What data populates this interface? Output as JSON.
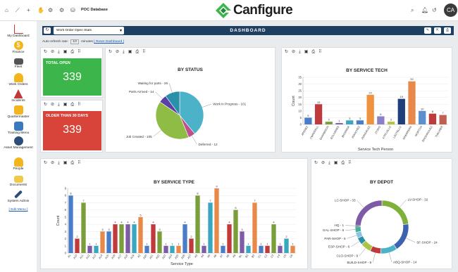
{
  "topbar": {
    "db_name": "POC Database",
    "brand": "Canfigure",
    "avatar": "CA"
  },
  "sidebar": {
    "items": [
      "My Dashboard",
      "Finance",
      "Fleet",
      "Work Orders",
      "Incidents",
      "Quartermaster",
      "Training Menu",
      "Asset Management",
      "People",
      "Documents",
      "System Admin"
    ],
    "edit": "[ Edit Menu ]"
  },
  "dashboard": {
    "title": "DASHBOARD",
    "select": "Work Order Open Stats",
    "auto_prefix": "Auto refresh rate:",
    "auto_value": "10",
    "auto_suffix": "minutes",
    "reset": "[ Reset Dashboard ]"
  },
  "kpis": {
    "open_label": "TOTAL OPEN",
    "open_value": "339",
    "old_label": "OLDER THAN 30 DAYS",
    "old_value": "339",
    "green": "#3cb54a",
    "red": "#d9443a"
  },
  "chart_data": [
    {
      "type": "pie",
      "title": "BY STATUS",
      "labels": [
        "Work in Progress - 101",
        "Deferred - 12",
        "Job Created - 105",
        "Parts Arrived - 14",
        "Waiting for parts - 26"
      ],
      "values": [
        101,
        12,
        105,
        14,
        26
      ],
      "colors": [
        "#4bb2c8",
        "#c0508c",
        "#8fbc44",
        "#5a3fa8",
        "#2a8fa8"
      ]
    },
    {
      "type": "bar",
      "title": "BY SERVICE TECH",
      "xlabel": "Service Tech  Person",
      "ylabel": "Count",
      "categories": [
        "APEREZ",
        "CWADDELL",
        "EHARBISON",
        "EOLIVARES",
        "JBOARDIA",
        "JSANCHEZ",
        "JSANDALEZ",
        "JTORO",
        "KTRUJILLO",
        "LSOTELLO",
        "MHERRERA",
        "MORTON",
        "RRODRIGUEZ",
        "THAUSER"
      ],
      "values": [
        5,
        15,
        2,
        1,
        3,
        3,
        22,
        6,
        2,
        19,
        32,
        10,
        8,
        7
      ],
      "colors": [
        "#4a7cc7",
        "#c0393b",
        "#7a9f3a",
        "#7d5ba6",
        "#3aa6c0",
        "#4a7cc7",
        "#f0913d",
        "#8b7fc7",
        "#b8c042",
        "#1f3f7a",
        "#e8894a",
        "#5a8fd0",
        "#c0393b",
        "#c05f50"
      ],
      "ylim": [
        0,
        35
      ]
    },
    {
      "type": "bar",
      "title": "BY SERVICE TYPE",
      "xlabel": "Service Type",
      "ylabel": "Count",
      "categories": [
        "A1",
        "A10",
        "A11",
        "A12",
        "A13",
        "A14",
        "A15",
        "A16",
        "A17",
        "A18",
        "A19",
        "A2",
        "A20",
        "A21",
        "A22",
        "A23",
        "A24",
        "A25",
        "A26",
        "A27",
        "A3",
        "A4",
        "A5",
        "A6",
        "A7",
        "A8",
        "A9",
        "B1",
        "B2",
        "B3",
        "C1",
        "C2",
        "C3",
        "C4",
        "C5",
        "C6"
      ],
      "values": [
        8,
        2,
        7,
        1,
        1,
        3,
        3,
        4,
        4,
        4,
        4,
        5,
        1,
        4,
        3,
        1,
        1,
        1,
        4,
        2,
        8,
        1,
        7,
        9,
        1,
        4,
        6,
        3,
        1,
        7,
        1,
        1,
        4,
        1,
        2,
        1
      ],
      "ylim": [
        0,
        9
      ]
    },
    {
      "type": "pie",
      "title": "BY DEPOT",
      "labels": [
        "LV-SHOP - 32",
        "SF-SHOP - 24",
        "ABQ-SHOP - 14",
        "BUILD-SHOP - 9",
        "CLO-SHOP - 9",
        "ESP-SHOP - 6",
        "PAR-SHOP - 5",
        "GAL-SHOP - 5",
        "HQ - 1",
        "LC-SHOP - 33"
      ],
      "values": [
        32,
        24,
        14,
        9,
        9,
        6,
        5,
        5,
        1,
        33
      ],
      "colors": [
        "#7fb03a",
        "#3d63b0",
        "#4bb2c8",
        "#c0393b",
        "#a8c442",
        "#2a8fa8",
        "#8bc4e0",
        "#4aaf9a",
        "#555",
        "#7d5ba6"
      ]
    }
  ]
}
